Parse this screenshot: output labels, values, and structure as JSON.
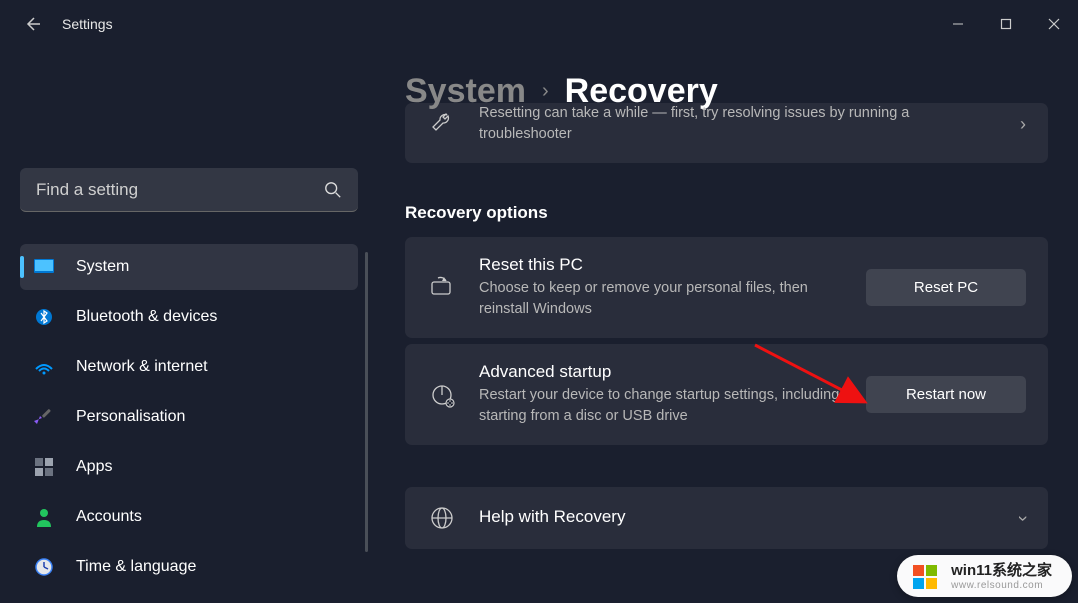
{
  "app_title": "Settings",
  "search": {
    "placeholder": "Find a setting"
  },
  "sidebar": {
    "items": [
      {
        "label": "System",
        "active": true
      },
      {
        "label": "Bluetooth & devices"
      },
      {
        "label": "Network & internet"
      },
      {
        "label": "Personalisation"
      },
      {
        "label": "Apps"
      },
      {
        "label": "Accounts"
      },
      {
        "label": "Time & language"
      }
    ]
  },
  "breadcrumb": {
    "parent": "System",
    "current": "Recovery"
  },
  "troubleshoot": {
    "desc": "Resetting can take a while — first, try resolving issues by running a troubleshooter"
  },
  "section_title": "Recovery options",
  "cards": {
    "reset": {
      "title": "Reset this PC",
      "desc": "Choose to keep or remove your personal files, then reinstall Windows",
      "button": "Reset PC"
    },
    "advanced": {
      "title": "Advanced startup",
      "desc": "Restart your device to change startup settings, including starting from a disc or USB drive",
      "button": "Restart now"
    },
    "help": {
      "title": "Help with Recovery"
    }
  },
  "watermark": {
    "main": "win11系统之家",
    "sub": "www.relsound.com"
  }
}
